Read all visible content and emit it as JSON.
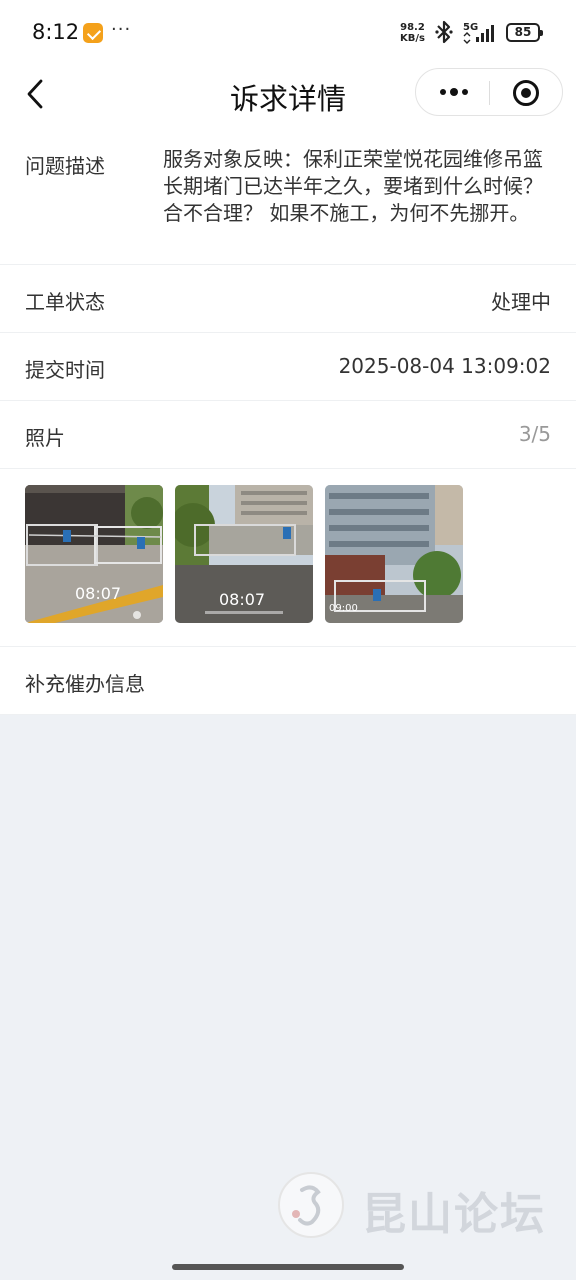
{
  "status_bar": {
    "time": "8:12",
    "more": "···",
    "speed_value": "98.2",
    "speed_unit": "KB/s",
    "network": "5G",
    "battery": "85"
  },
  "nav": {
    "title": "诉求详情"
  },
  "detail": {
    "desc_label": "问题描述",
    "desc_text": "服务对象反映：保利正荣堂悦花园维修吊篮长期堵门已达半年之久，要堵到什么时候？合不合理？ 如果不施工，为何不先挪开。",
    "status_label": "工单状态",
    "status_value": "处理中",
    "time_label": "提交时间",
    "time_value": "2025-08-04 13:09:02",
    "photos_label": "照片",
    "photos_count": "3/5",
    "photos": [
      {
        "stamp": "08:07"
      },
      {
        "stamp": "08:07"
      },
      {
        "stamp": "09:00"
      }
    ],
    "extra_label": "补充催办信息"
  },
  "watermark": {
    "text": "昆山论坛"
  }
}
